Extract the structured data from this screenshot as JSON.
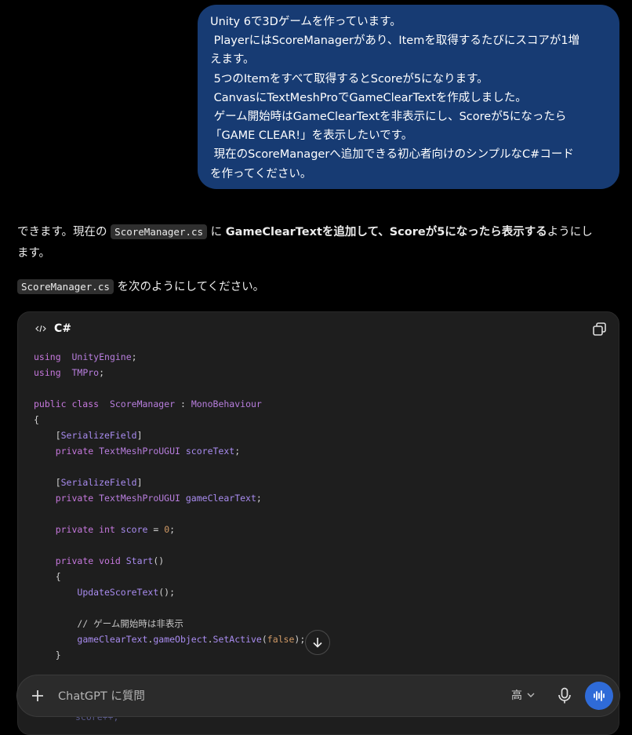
{
  "user_message": {
    "lines": [
      "Unity 6で3Dゲームを作っています。",
      " PlayerにはScoreManagerがあり、Itemを取得するたびにスコアが1増",
      "えます。",
      " 5つのItemをすべて取得するとScoreが5になります。",
      " CanvasにTextMeshProでGameClearTextを作成しました。",
      " ゲーム開始時はGameClearTextを非表示にし、Scoreが5になったら",
      "「GAME CLEAR!」を表示したいです。",
      " 現在のScoreManagerへ追加できる初心者向けのシンプルなC#コード",
      "を作ってください。"
    ]
  },
  "reply": {
    "p1_a": "できます。現在の ",
    "p1_code": "ScoreManager.cs",
    "p1_b": " に ",
    "p1_bold": "GameClearTextを追加して、Scoreが5になったら表示する",
    "p1_c": "ようにし",
    "p1_d": "ます。",
    "p2_code": "ScoreManager.cs",
    "p2_text": " を次のようにしてください。"
  },
  "code_block": {
    "language": "C#",
    "lines": [
      {
        "t": [
          [
            "kw",
            "using"
          ],
          [
            "",
            "  "
          ],
          [
            "ty",
            "UnityEngine"
          ],
          [
            "",
            ";"
          ]
        ]
      },
      {
        "t": [
          [
            "kw",
            "using"
          ],
          [
            "",
            "  "
          ],
          [
            "ty",
            "TMPro"
          ],
          [
            "",
            ";"
          ]
        ]
      },
      {
        "t": []
      },
      {
        "t": [
          [
            "kw",
            "public class"
          ],
          [
            "",
            "  "
          ],
          [
            "ty",
            "ScoreManager"
          ],
          [
            "",
            " : "
          ],
          [
            "ty",
            "MonoBehaviour"
          ]
        ]
      },
      {
        "t": [
          [
            "",
            "{"
          ]
        ]
      },
      {
        "t": [
          [
            "",
            "    ["
          ],
          [
            "at",
            "SerializeField"
          ],
          [
            "",
            "]"
          ]
        ]
      },
      {
        "t": [
          [
            "",
            "    "
          ],
          [
            "kw",
            "private"
          ],
          [
            "",
            ""
          ],
          [
            "ty",
            " TextMeshProUGUI"
          ],
          [
            "",
            ""
          ],
          [
            "at",
            " scoreText"
          ],
          [
            "",
            ";"
          ]
        ]
      },
      {
        "t": []
      },
      {
        "t": [
          [
            "",
            "    ["
          ],
          [
            "at",
            "SerializeField"
          ],
          [
            "",
            "]"
          ]
        ]
      },
      {
        "t": [
          [
            "",
            "    "
          ],
          [
            "kw",
            "private"
          ],
          [
            "ty",
            " TextMeshProUGUI"
          ],
          [
            "at",
            " gameClearText"
          ],
          [
            "",
            ";"
          ]
        ]
      },
      {
        "t": []
      },
      {
        "t": [
          [
            "",
            "    "
          ],
          [
            "kw",
            "private int"
          ],
          [
            "at",
            " score"
          ],
          [
            "",
            " = "
          ],
          [
            "num",
            "0"
          ],
          [
            "",
            ";"
          ]
        ]
      },
      {
        "t": []
      },
      {
        "t": [
          [
            "",
            "    "
          ],
          [
            "kw",
            "private void"
          ],
          [
            "fn",
            " Start"
          ],
          [
            "",
            "()"
          ]
        ]
      },
      {
        "t": [
          [
            "",
            "    {"
          ]
        ]
      },
      {
        "t": [
          [
            "",
            "        "
          ],
          [
            "fn",
            "UpdateScoreText"
          ],
          [
            "",
            "();"
          ]
        ]
      },
      {
        "t": []
      },
      {
        "t": [
          [
            "cm",
            "        // ゲーム開始時は非表示"
          ]
        ]
      },
      {
        "t": [
          [
            "",
            "        "
          ],
          [
            "fn",
            "gameClearText"
          ],
          [
            "",
            "."
          ],
          [
            "fn",
            "gameObject"
          ],
          [
            "",
            "."
          ],
          [
            "fn",
            "SetActive"
          ],
          [
            "",
            "("
          ],
          [
            "num",
            "false"
          ],
          [
            "",
            ");"
          ]
        ]
      },
      {
        "t": [
          [
            "",
            "    }"
          ]
        ]
      }
    ],
    "copy_icon": "copy-icon",
    "hidden_line": "score++;"
  },
  "composer": {
    "placeholder": "ChatGPT に質問",
    "model_label": "高",
    "plus_icon": "plus-icon",
    "mic_icon": "microphone-icon",
    "voice_icon": "voice-waveform-icon"
  },
  "colors": {
    "user_bubble": "#173b73",
    "voice_button": "#2f6bd8",
    "keyword": "#c678dd",
    "number": "#d19a66"
  }
}
